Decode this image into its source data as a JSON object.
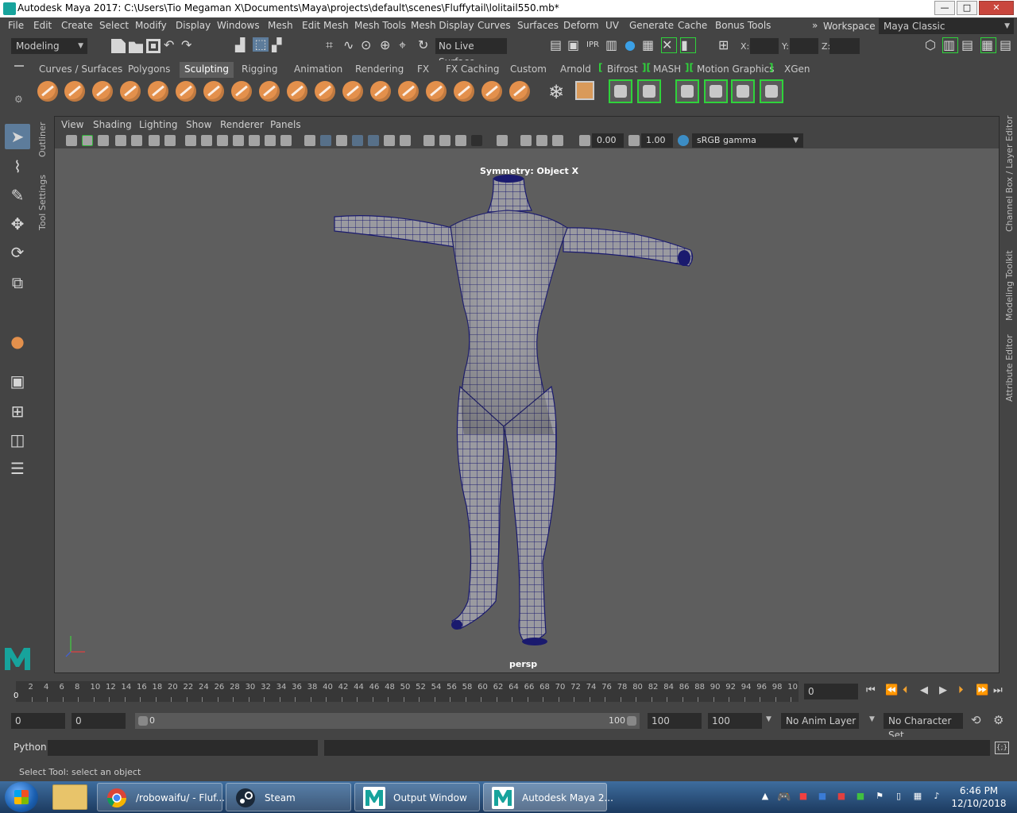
{
  "window": {
    "title": "Autodesk Maya 2017: C:\\Users\\Tio Megaman X\\Documents\\Maya\\projects\\default\\scenes\\Fluffytail\\lolitail550.mb*",
    "minimize": "—",
    "maximize": "□",
    "close": "✕"
  },
  "menubar": {
    "items": [
      "File",
      "Edit",
      "Create",
      "Select",
      "Modify",
      "Display",
      "Windows",
      "Mesh",
      "Edit Mesh",
      "Mesh Tools",
      "Mesh Display",
      "Curves",
      "Surfaces",
      "Deform",
      "UV",
      "Generate",
      "Cache",
      "Bonus Tools"
    ],
    "workspace_label": "Workspace :",
    "workspace_value": "Maya Classic"
  },
  "statusline": {
    "menu_set": "Modeling",
    "live_surface": "No Live Surface",
    "x_label": "X:",
    "y_label": "Y:",
    "z_label": "Z:"
  },
  "shelf": {
    "tabs": [
      "Curves / Surfaces",
      "Polygons",
      "Sculpting",
      "Rigging",
      "Animation",
      "Rendering",
      "FX",
      "FX Caching",
      "Custom",
      "Arnold",
      "Bifrost",
      "MASH",
      "Motion Graphics",
      "XGen"
    ],
    "active_tab": "Sculpting"
  },
  "side_tabs": {
    "left": [
      "Outliner",
      "Tool Settings"
    ],
    "right": [
      "Channel Box / Layer Editor",
      "Modeling Toolkit",
      "Attribute Editor"
    ]
  },
  "viewport": {
    "menus": [
      "View",
      "Shading",
      "Lighting",
      "Show",
      "Renderer",
      "Panels"
    ],
    "exposure": "0.00",
    "gamma": "1.00",
    "color_space": "sRGB gamma",
    "symmetry_label": "Symmetry: Object X",
    "camera_label": "persp",
    "mesh_color": "#9a9aa0",
    "wire_color": "#1a1a6e",
    "background": "#5e5e5e"
  },
  "timeslider": {
    "ticks": [
      "2",
      "4",
      "6",
      "8",
      "10",
      "12",
      "14",
      "16",
      "18",
      "20",
      "22",
      "24",
      "26",
      "28",
      "30",
      "32",
      "34",
      "36",
      "38",
      "40",
      "42",
      "44",
      "46",
      "48",
      "50",
      "52",
      "54",
      "56",
      "58",
      "60",
      "62",
      "64",
      "66",
      "68",
      "70",
      "72",
      "74",
      "76",
      "78",
      "80",
      "82",
      "84",
      "86",
      "88",
      "90",
      "92",
      "94",
      "96",
      "98",
      "10"
    ],
    "current_frame_marker": "0",
    "current_frame": "0"
  },
  "rangeslider": {
    "start_time": "0",
    "playback_start": "0",
    "range_start": "0",
    "range_end": "100",
    "playback_end": "100",
    "end_time": "100",
    "anim_layer": "No Anim Layer",
    "character_set": "No Character Set"
  },
  "cmdline": {
    "language": "Python"
  },
  "helpline": {
    "text": "Select Tool: select an object"
  },
  "taskbar": {
    "buttons": [
      {
        "label": "/robowaifu/ - Fluf..."
      },
      {
        "label": "Steam"
      },
      {
        "label": "Output Window"
      },
      {
        "label": "Autodesk Maya 2..."
      }
    ],
    "time": "6:46 PM",
    "date": "12/10/2018"
  }
}
